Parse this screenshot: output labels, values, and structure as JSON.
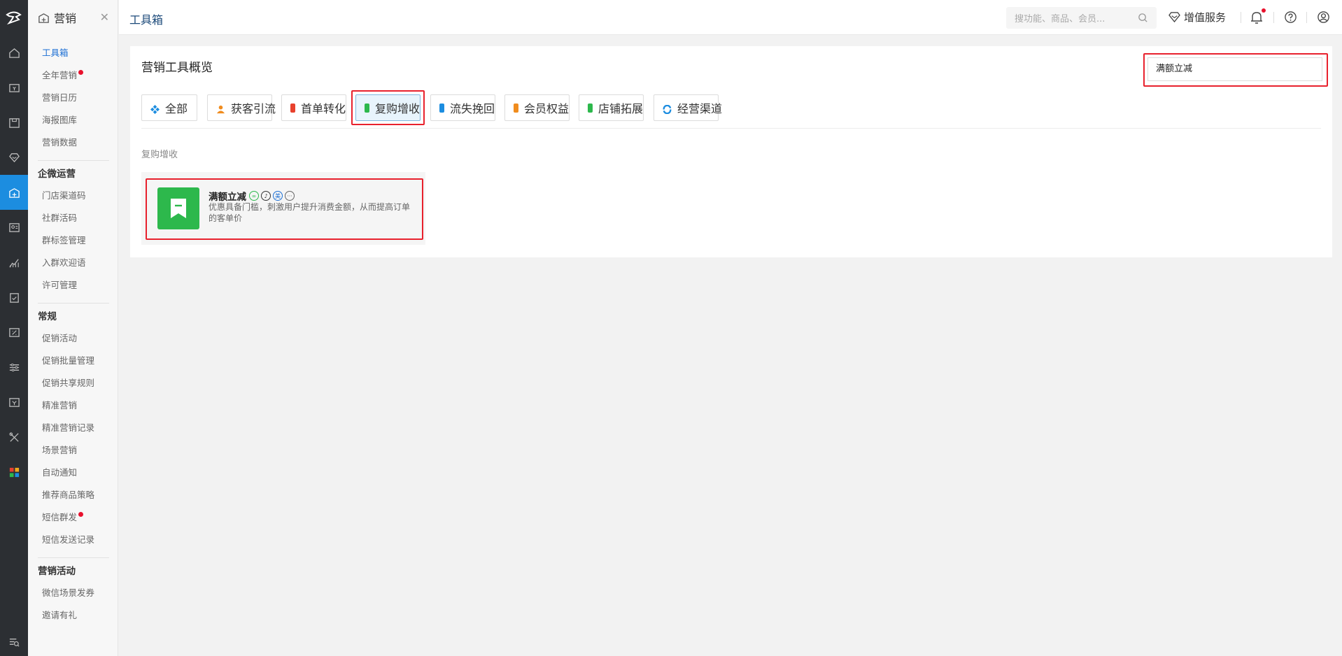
{
  "sidebar": {
    "title": "营销",
    "items": [
      {
        "label": "工具箱",
        "active": true
      },
      {
        "label": "全年营销",
        "dot": true
      },
      {
        "label": "营销日历"
      },
      {
        "label": "海报图库"
      },
      {
        "label": "营销数据"
      }
    ],
    "groups": [
      {
        "title": "企微运营",
        "items": [
          {
            "label": "门店渠道码"
          },
          {
            "label": "社群活码"
          },
          {
            "label": "群标签管理"
          },
          {
            "label": "入群欢迎语"
          },
          {
            "label": "许可管理"
          }
        ]
      },
      {
        "title": "常规",
        "items": [
          {
            "label": "促销活动"
          },
          {
            "label": "促销批量管理"
          },
          {
            "label": "促销共享规则"
          },
          {
            "label": "精准营销"
          },
          {
            "label": "精准营销记录"
          },
          {
            "label": "场景营销"
          },
          {
            "label": "自动通知"
          },
          {
            "label": "推荐商品策略"
          },
          {
            "label": "短信群发",
            "dot": true
          },
          {
            "label": "短信发送记录"
          }
        ]
      },
      {
        "title": "营销活动",
        "items": [
          {
            "label": "微信场景发券"
          },
          {
            "label": "邀请有礼"
          }
        ]
      }
    ]
  },
  "topbar": {
    "title": "工具箱",
    "search_placeholder": "搜功能、商品、会员...",
    "vip_label": "增值服务"
  },
  "main": {
    "title": "营销工具概览",
    "search_value": "满额立减",
    "tabs": [
      {
        "label": "全部",
        "icon": "diamond-grid-icon",
        "color": "#1c8de0"
      },
      {
        "label": "获客引流",
        "icon": "people-icon",
        "color": "#f08c1e"
      },
      {
        "label": "首单转化",
        "icon": "clipboard-icon",
        "color": "#e8412d"
      },
      {
        "label": "复购增收",
        "icon": "repeat-icon",
        "color": "#2db84c",
        "active": true
      },
      {
        "label": "流失挽回",
        "icon": "return-icon",
        "color": "#1c8de0"
      },
      {
        "label": "会员权益",
        "icon": "vip-bag-icon",
        "color": "#f08c1e"
      },
      {
        "label": "店铺拓展",
        "icon": "store-icon",
        "color": "#2db84c"
      },
      {
        "label": "经营渠道",
        "icon": "channel-icon",
        "color": "#1c8de0"
      }
    ],
    "section_label": "复购增收",
    "tool": {
      "name": "满额立减",
      "desc": "优惠具备门槛，刺激用户提升消费金额，从而提高订单的客单价",
      "icon": "bookmark-icon",
      "icon_color": "#2db84c"
    }
  }
}
